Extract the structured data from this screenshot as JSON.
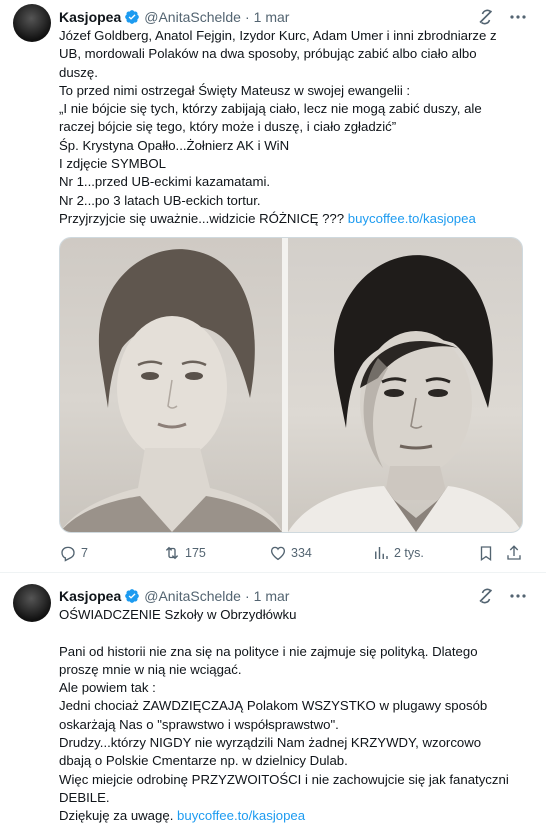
{
  "tweets": [
    {
      "author": "Kasjopea",
      "handle": "@AnitaSchelde",
      "separator": "·",
      "date": "1 mar",
      "lines": [
        "Józef Goldberg, Anatol Fejgin, Izydor Kurc, Adam Umer i inni zbrodniarze z",
        "UB, mordowali Polaków na dwa sposoby, próbując zabić albo ciało albo",
        "duszę.",
        "To przed nimi ostrzegał Święty Mateusz w swojej ewangelii :",
        "„I nie bójcie się tych, którzy zabijają ciało, lecz nie mogą zabić duszy, ale",
        "raczej bójcie się tego, który może i duszę, i ciało zgładzić”",
        "Śp. Krystyna Opałło...Żołnierz AK i WiN",
        "I zdjęcie SYMBOL",
        "Nr 1...przed UB-eckimi kazamatami.",
        "Nr 2...po 3 latach UB-eckich tortur.",
        "Przyjrzyjcie się uważnie...widzicie RÓŻNICĘ ???"
      ],
      "link": "buycoffee.to/kasjopea",
      "actions": {
        "replies": "7",
        "reposts": "175",
        "likes": "334",
        "views": "2 tys."
      }
    },
    {
      "author": "Kasjopea",
      "handle": "@AnitaSchelde",
      "separator": "·",
      "date": "1 mar",
      "lines": [
        "OŚWIADCZENIE Szkoły w Obrzydłówku",
        "",
        "Pani od historii nie zna się na polityce i nie zajmuje się polityką. Dlatego",
        "proszę mnie w nią nie wciągać.",
        "Ale powiem tak :",
        "Jedni chociaż ZAWDZIĘCZAJĄ Polakom WSZYSTKO w plugawy sposób",
        "oskarżają Nas o \"sprawstwo i współsprawstwo\".",
        "Drudzy...którzy NIGDY nie wyrządzili Nam żadnej KRZYWDY, wzorcowo",
        "dbają o Polskie Cmentarze np. w dzielnicy Dulab.",
        "Więc miejcie odrobinę PRZYZWOITOŚCI i nie zachowujcie się jak fanatyczni",
        "DEBILE.",
        "Dziękuję za uwagę."
      ],
      "link": "buycoffee.to/kasjopea"
    }
  ],
  "icons": {
    "verified": "verified-badge-icon",
    "grok": "grok-icon",
    "more": "more-icon",
    "reply": "reply-icon",
    "repost": "repost-icon",
    "like": "like-icon",
    "views": "views-icon",
    "bookmark": "bookmark-icon",
    "share": "share-icon"
  },
  "colors": {
    "link": "#1d9bf0",
    "secondary_text": "#536471",
    "verified": "#1d9bf0"
  }
}
